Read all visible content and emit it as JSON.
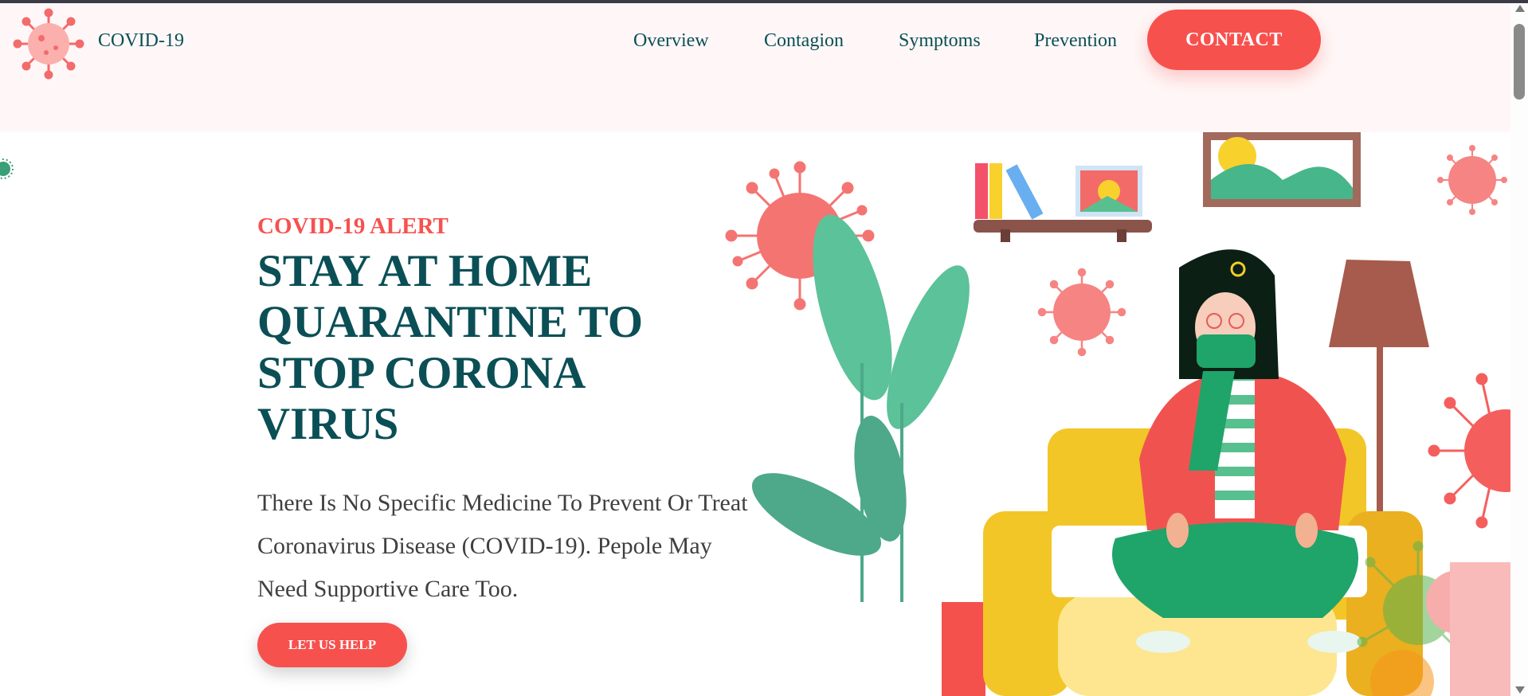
{
  "header": {
    "brand": "COVID-19",
    "logo_icon": "virus-logo-icon",
    "nav": [
      "Overview",
      "Contagion",
      "Symptoms",
      "Prevention"
    ],
    "contact_label": "CONTACT"
  },
  "hero": {
    "alert": "COVID-19 ALERT",
    "headline": "STAY AT HOME QUARANTINE TO STOP CORONA VIRUS",
    "description": "There Is No Specific Medicine To Prevent Or Treat Coronavirus Disease (COVID-19). Pepole May Need Supportive Care Too.",
    "cta_label": "LET US HELP"
  },
  "colors": {
    "accent": "#f7514e",
    "heading": "#0b4f56",
    "header_bg": "#fff7f7",
    "plant_green": "#5bc29a",
    "sofa_yellow": "#f3c627"
  }
}
